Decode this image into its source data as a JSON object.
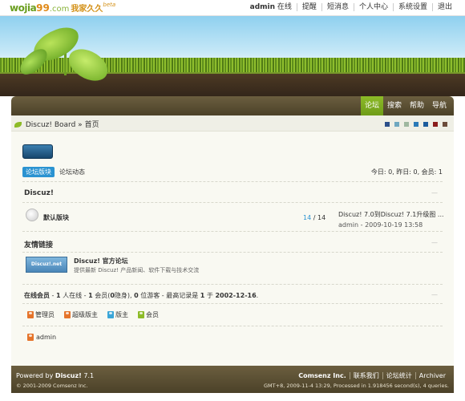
{
  "topbar": {
    "logo_en_prefix": "wo",
    "logo_en_mid": "jia",
    "logo_num": "99",
    "logo_domain": ".com",
    "logo_cn": "我家久久",
    "logo_beta": "beta",
    "user": "admin",
    "user_status": "在线",
    "links": [
      "提醒",
      "短消息",
      "个人中心",
      "系统设置",
      "退出"
    ]
  },
  "nav": {
    "tabs": [
      {
        "label": "论坛",
        "active": true
      },
      {
        "label": "搜索",
        "active": false
      },
      {
        "label": "帮助",
        "active": false
      },
      {
        "label": "导航",
        "active": false
      }
    ]
  },
  "breadcrumb": {
    "board": "Discuz! Board",
    "separator": "»",
    "current": "首页"
  },
  "style_swatches": [
    "#2b4f8a",
    "#6fa8c0",
    "#9fb8a0",
    "#2b7ab8",
    "#1c5c9c",
    "#8a1c1c",
    "#6b4b3a"
  ],
  "subtabs": {
    "active": "论坛版块",
    "other": "论坛动态"
  },
  "stats_text": "今日: 0, 昨日: 0, 会员: 1",
  "category": {
    "title": "Discuz!",
    "collapse": "—"
  },
  "forum": {
    "name": "默认版块",
    "topics": "14",
    "slash": "/",
    "posts": "14",
    "last_title": "Discuz! 7.0到Discuz! 7.1升级图 ...",
    "last_user": "admin",
    "last_time": "2009-10-19 13:58"
  },
  "friend_links": {
    "title": "友情链接",
    "collapse": "—",
    "logo_text": "Discuz!.net",
    "name": "Discuz! 官方论坛",
    "desc": "提供最新 Discuz! 产品新闻、软件下载与技术交流"
  },
  "online": {
    "label": "在线会员",
    "dash1": "-",
    "count_online": "1",
    "t1": "人在线 -",
    "count_members": "1",
    "t2": "会员(",
    "count_hidden": "0",
    "t3": "隐身),",
    "count_guests": "0",
    "t4": "位游客 - 最高记录是",
    "record": "1",
    "t5": "于",
    "record_date": "2002-12-16",
    "t6": ".",
    "collapse": "—",
    "legend": [
      {
        "label": "管理员",
        "color": "#e5742b"
      },
      {
        "label": "超级版主",
        "color": "#e5742b"
      },
      {
        "label": "版主",
        "color": "#3ba6d8"
      },
      {
        "label": "会员",
        "color": "#8dbb28"
      }
    ],
    "users": [
      {
        "name": "admin",
        "color": "#e5742b"
      }
    ]
  },
  "footer": {
    "powered": "Powered by",
    "product": "Discuz!",
    "version": "7.1",
    "copyright": "© 2001-2009 Comsenz Inc.",
    "links": [
      "Comsenz Inc.",
      "联系我们",
      "论坛统计",
      "Archiver"
    ],
    "processed": "GMT+8, 2009-11-4 13:29, Processed in 1.918456 second(s), 4 queries."
  }
}
